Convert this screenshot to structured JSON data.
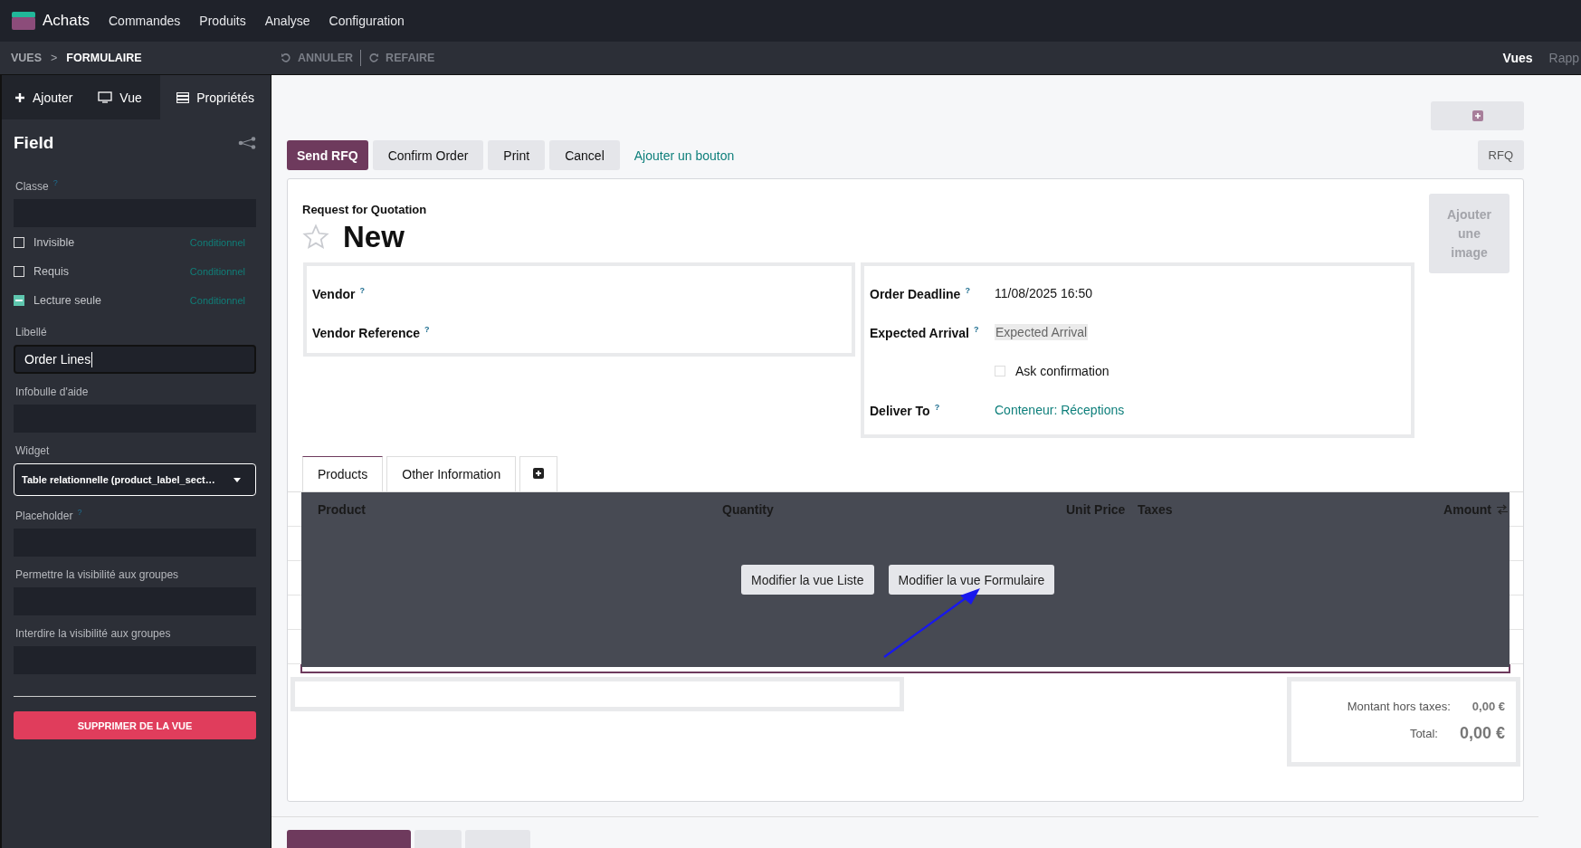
{
  "app": {
    "name": "Achats",
    "menu": [
      "Commandes",
      "Produits",
      "Analyse",
      "Configuration"
    ]
  },
  "breadcrumb": {
    "items": [
      "VUES",
      "FORMULAIRE"
    ],
    "separator": ">"
  },
  "history": [
    {
      "label": "ANNULER",
      "kind": "undo"
    },
    {
      "label": "REFAIRE",
      "kind": "redo"
    }
  ],
  "top_right": [
    "Vues",
    "Rapp"
  ],
  "sidebar_tabs": [
    {
      "label": "Ajouter",
      "kind": "add",
      "selected": false
    },
    {
      "label": "Vue",
      "kind": "view",
      "selected": false
    },
    {
      "label": "Propriétés",
      "kind": "properties",
      "selected": true
    }
  ],
  "panel": {
    "title": "Field",
    "fields": [
      {
        "kind": "input",
        "label": "Classe",
        "help": "?"
      },
      {
        "kind": "checkbox",
        "label": "Invisible",
        "checked": false,
        "link": "Conditionnel"
      },
      {
        "kind": "checkbox",
        "label": "Requis",
        "checked": false,
        "link": "Conditionnel"
      },
      {
        "kind": "checkbox",
        "label": "Lecture seule",
        "checked": true,
        "link": "Conditionnel"
      },
      {
        "kind": "input",
        "label": "Libellé",
        "value": "Order Lines",
        "focused": true
      },
      {
        "kind": "input",
        "label": "Infobulle d'aide"
      },
      {
        "kind": "select",
        "label": "Widget",
        "value": "Table relationnelle (product_label_sect…"
      },
      {
        "kind": "input",
        "label": "Placeholder",
        "help": "?"
      },
      {
        "kind": "input",
        "label": "Permettre la visibilité aux groupes"
      },
      {
        "kind": "input",
        "label": "Interdire la visibilité aux groupes"
      }
    ],
    "delete_button": "SUPPRIMER DE LA VUE"
  },
  "actions": [
    {
      "label": "Send RFQ",
      "primary": true
    },
    {
      "label": "Confirm Order",
      "primary": false
    },
    {
      "label": "Print",
      "primary": false
    },
    {
      "label": "Cancel",
      "primary": false
    }
  ],
  "add_button_link": "Ajouter un bouton",
  "status": "RFQ",
  "sheet": {
    "subtitle": "Request for Quotation",
    "title": "New",
    "favorite": false,
    "image_button": "Ajouter une image",
    "left_group": [
      {
        "label": "Vendor",
        "help": "?"
      },
      {
        "label": "Vendor Reference",
        "help": "?"
      }
    ],
    "right_group": [
      {
        "kind": "text",
        "label": "Order Deadline",
        "help": "?",
        "value": "11/08/2025 16:50"
      },
      {
        "kind": "placeholder",
        "label": "Expected Arrival",
        "help": "?",
        "placeholder": "Expected Arrival"
      },
      {
        "kind": "checkbox",
        "label": "Ask confirmation",
        "checked": false
      },
      {
        "kind": "link",
        "label": "Deliver To",
        "help": "?",
        "value": "Conteneur: Réceptions"
      }
    ],
    "tabs": [
      {
        "label": "Products",
        "selected": true
      },
      {
        "label": "Other Information",
        "selected": false
      }
    ],
    "table": {
      "columns": [
        "Product",
        "Quantity",
        "Unit Price",
        "Taxes",
        "Amount"
      ]
    },
    "overlay_buttons": [
      "Modifier la vue Liste",
      "Modifier la vue Formulaire"
    ],
    "totals": [
      {
        "kind": "subtotal",
        "label": "Montant hors taxes:",
        "value": "0,00 €"
      },
      {
        "kind": "total",
        "label": "Total:",
        "value": "0,00 €"
      }
    ]
  }
}
